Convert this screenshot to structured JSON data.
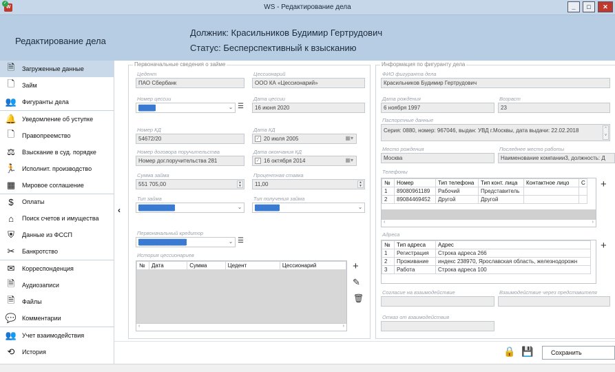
{
  "window": {
    "title": "WS - Редактирование дела",
    "app_icon_letter": "W",
    "minimize": "_",
    "maximize": "□",
    "close": "✕"
  },
  "header": {
    "title": "Редактирование дела",
    "debtor": "Должник: Красильников Будимир Гертрудович",
    "status": "Статус: Бесперспективный к взысканию"
  },
  "sidebar": {
    "items": [
      {
        "label": "Загруженные данные",
        "icon": "upload-doc-icon",
        "glyph": "🗎"
      },
      {
        "label": "Займ",
        "icon": "document-icon",
        "glyph": "🗋"
      },
      {
        "label": "Фигуранты дела",
        "icon": "people-icon",
        "glyph": "👥"
      },
      {
        "label": "Уведомление об уступке",
        "icon": "bell-icon",
        "glyph": "🔔"
      },
      {
        "label": "Правопреемство",
        "icon": "doc-arrow-icon",
        "glyph": "🗋"
      },
      {
        "label": "Взыскание в суд. порядке",
        "icon": "court-icon",
        "glyph": "⚖"
      },
      {
        "label": "Исполнит. производство",
        "icon": "runner-icon",
        "glyph": "🏃"
      },
      {
        "label": "Мировое соглашение",
        "icon": "calendar-icon",
        "glyph": "▦"
      },
      {
        "label": "Оплаты",
        "icon": "dollar-icon",
        "glyph": "$"
      },
      {
        "label": "Поиск счетов и имущества",
        "icon": "house-search-icon",
        "glyph": "⌂"
      },
      {
        "label": "Данные из ФССП",
        "icon": "shield-icon",
        "glyph": "⛨"
      },
      {
        "label": "Банкротство",
        "icon": "broken-icon",
        "glyph": "✂"
      },
      {
        "label": "Корреспонденция",
        "icon": "mail-icon",
        "glyph": "✉"
      },
      {
        "label": "Аудиозаписи",
        "icon": "audio-icon",
        "glyph": "🗎"
      },
      {
        "label": "Файлы",
        "icon": "file-icon",
        "glyph": "🗎"
      },
      {
        "label": "Комментарии",
        "icon": "comment-icon",
        "glyph": "💬"
      },
      {
        "label": "Учет взаимодействия",
        "icon": "interaction-icon",
        "glyph": "👥"
      },
      {
        "label": "История",
        "icon": "history-icon",
        "glyph": "⟲"
      }
    ],
    "collapse": "‹"
  },
  "loan": {
    "group_title": "Первоначальные сведения о займе",
    "creditor_label": "Цедент",
    "creditor": "ПАО Сбербанк",
    "assignee_label": "Цессионарий",
    "assignee": "ООО КА «Цессионарий»",
    "cession_no_label": "Номер цессии",
    "cession_no": "████",
    "cession_date_label": "Дата цессии",
    "cession_date": "16 июня 2020",
    "kd_no_label": "Номер КД",
    "kd_no": "54672/20",
    "kd_date_label": "Дата КД",
    "kd_date": "20   июля   2005",
    "surety_label": "Номер договора поручительства",
    "surety": "Номер дог.поручительства 281",
    "kd_end_label": "Дата окончания КД",
    "kd_end": "16  октября  2014",
    "amount_label": "Сумма займа",
    "amount": "551 705,00",
    "rate_label": "Процентная ставка",
    "rate": "11,00",
    "loan_type_label": "Тип займа",
    "loan_type": "█████████",
    "receive_type_label": "Тип получения займа",
    "receive_type": "██████",
    "orig_creditor_label": "Первоначальный кредитор",
    "orig_creditor": "████████████",
    "history_label": "История цессионариев",
    "history_cols": [
      "№",
      "Дата",
      "Сумма",
      "Цедент",
      "Цессионарий"
    ]
  },
  "person": {
    "group_title": "Информация по фигуранту дела",
    "fio_label": "ФИО фигуранта дела",
    "fio": "Красильников Будимир Гертрудович",
    "birth_label": "Дата рождения",
    "birth": "6 ноября 1997",
    "age_label": "Возраст",
    "age": "23",
    "passport_label": "Паспортные данные",
    "passport": "Серия: 0880, номер: 967046, выдан: УВД г.Москвы, дата выдачи: 22.02.2018",
    "birthplace_label": "Место рождения",
    "birthplace": "Москва",
    "work_label": "Последнее место работы",
    "work": "Наименование компании3, должность: Д",
    "phones_label": "Телефоны",
    "phone_cols": [
      "№",
      "Номер",
      "Тип телефона",
      "Тип конт. лица",
      "Контактное лицо",
      "С"
    ],
    "phones": [
      [
        "1",
        "89080961189",
        "Рабочий",
        "Представитель",
        "",
        ""
      ],
      [
        "2",
        "89084469452",
        "Другой",
        "Другой",
        "",
        ""
      ]
    ],
    "addresses_label": "Адреса",
    "address_cols": [
      "№",
      "Тип адреса",
      "Адрес"
    ],
    "addresses": [
      [
        "1",
        "Регистрация",
        "Строка адреса 266"
      ],
      [
        "2",
        "Проживание",
        "индекс 238970, Ярославская область, железнодорожн"
      ],
      [
        "3",
        "Работа",
        "Строка адреса 100"
      ]
    ],
    "consent_label": "Согласие на взаимодействие",
    "rep_label": "Взаимодействие через представителя",
    "refusal_label": "Отказ от взаимодействия"
  },
  "footer": {
    "save": "Сохранить"
  }
}
